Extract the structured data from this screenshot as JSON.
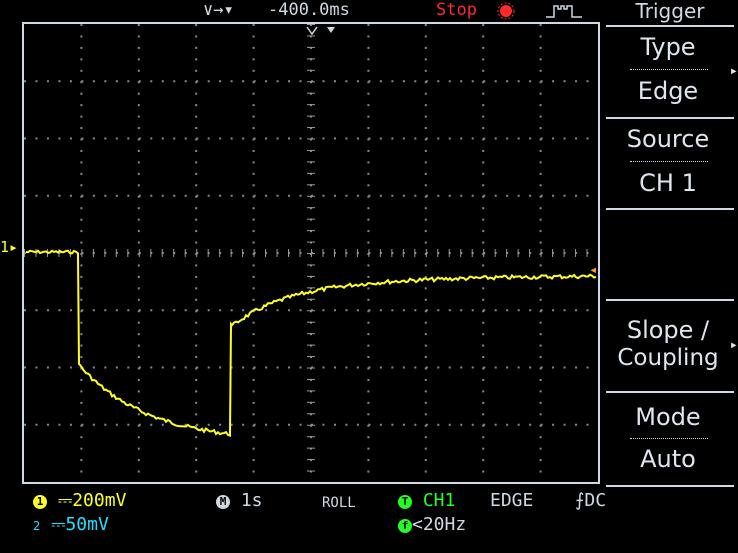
{
  "top": {
    "trigger_pos_marker": "∨→▾",
    "time_offset": "-400.0ms",
    "run_state": "Stop",
    "trigger_title": "Trigger"
  },
  "menu": {
    "type_label": "Type",
    "type_value": "Edge",
    "source_label": "Source",
    "source_value": "CH 1",
    "slope_label_1": "Slope /",
    "slope_label_2": "Coupling",
    "mode_label": "Mode",
    "mode_value": "Auto"
  },
  "screen": {
    "ch1_marker": "1▸",
    "trace_color": "#ffff22",
    "trigger_level_marker": "◂"
  },
  "status": {
    "ch1_badge": "1",
    "ch1_coupling": "⎓",
    "ch1_scale": "200mV",
    "ch2_badge": "2",
    "ch2_coupling": "⎓",
    "ch2_scale": "50mV",
    "time_badge": "M",
    "time_scale": "1s",
    "acq_mode": "ROLL",
    "trig_badge": "T",
    "trig_source": "CH1",
    "trig_type": "EDGE",
    "trig_slope": "⨍",
    "trig_coupling": "DC",
    "freq_badge": "f",
    "freq_value": "<20Hz"
  }
}
